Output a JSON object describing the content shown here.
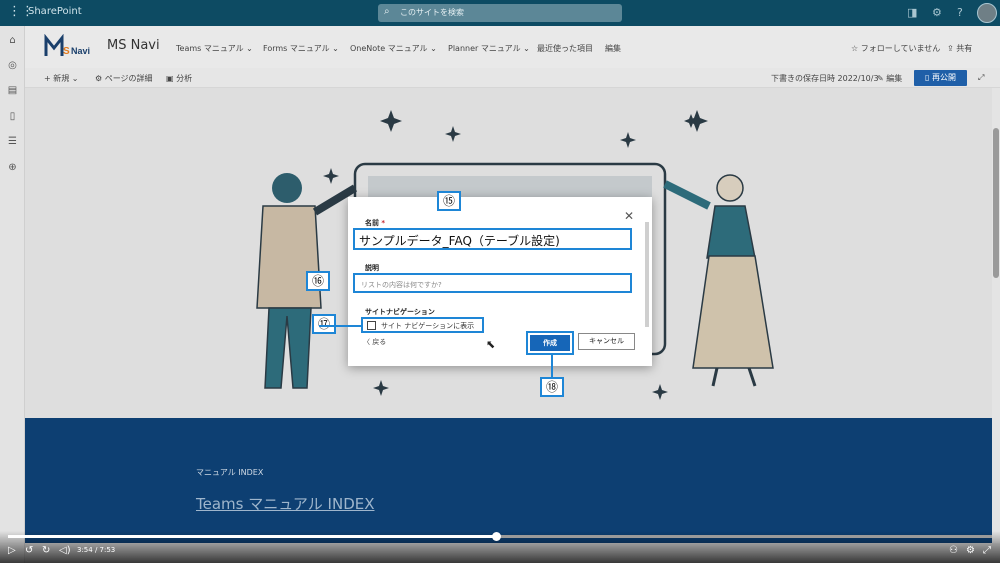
{
  "suite": {
    "brand": "SharePoint",
    "search_placeholder": "このサイトを検索"
  },
  "site": {
    "logo_text": "MSNavi",
    "name": "MS Navi",
    "nav": [
      "Teams マニュアル ⌄",
      "Forms マニュアル ⌄",
      "OneNote マニュアル ⌄",
      "Planner マニュアル ⌄",
      "最近使った項目",
      "編集"
    ],
    "follow": "☆ フォローしていません",
    "share": "共有"
  },
  "cmd": {
    "new": "新規 ⌄",
    "page_details": "ページの詳細",
    "analytics": "分析",
    "saved": "下書きの保存日時 2022/10/3",
    "edit": "編集",
    "republish": "再公開"
  },
  "dialog": {
    "name_label": "名前",
    "name_value": "サンプルデータ_FAQ（テーブル設定)",
    "desc_label": "説明",
    "desc_placeholder": "リストの内容は何ですか?",
    "nav_label": "サイトナビゲーション",
    "nav_checkbox_label": "サイト ナビゲーションに表示",
    "back": "戻る",
    "create": "作成",
    "cancel": "キャンセル"
  },
  "callouts": [
    "⑮",
    "⑯",
    "⑰",
    "⑱"
  ],
  "banner": {
    "caption": "マニュアル INDEX",
    "link": "Teams マニュアル INDEX"
  },
  "player": {
    "time": "3:54 / 7:53",
    "progress": 0.496
  },
  "colors": {
    "suitebar": "#0d4b63",
    "accent": "#1e86d6",
    "banner": "#0d3f72"
  }
}
